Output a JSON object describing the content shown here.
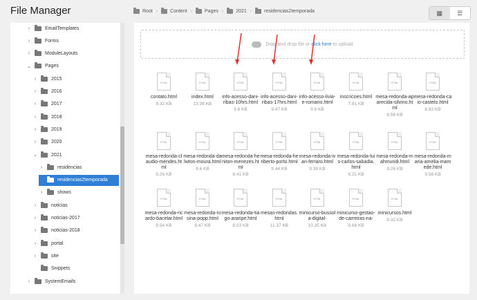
{
  "header": {
    "title": "File Manager"
  },
  "breadcrumb": [
    "Root",
    "Content",
    "Pages",
    "2021",
    "residencias2temporada"
  ],
  "view_toggle": {
    "grid_icon": "grid-icon",
    "list_icon": "list-icon"
  },
  "sidebar": {
    "items": [
      {
        "label": "EmailTemplates",
        "expanded": false
      },
      {
        "label": "Forms",
        "expanded": false
      },
      {
        "label": "ModuleLayouts",
        "expanded": false
      },
      {
        "label": "Pages",
        "expanded": true
      },
      {
        "label": "2015",
        "expanded": false
      },
      {
        "label": "2016",
        "expanded": false
      },
      {
        "label": "2017",
        "expanded": false
      },
      {
        "label": "2018",
        "expanded": false
      },
      {
        "label": "2019",
        "expanded": false
      },
      {
        "label": "2020",
        "expanded": false
      },
      {
        "label": "2021",
        "expanded": true
      },
      {
        "label": "residencias",
        "expanded": false
      },
      {
        "label": "residencias2temporada",
        "expanded": false,
        "selected": true
      },
      {
        "label": "shows",
        "expanded": false
      },
      {
        "label": "noticias",
        "expanded": false
      },
      {
        "label": "noticias-2017",
        "expanded": false
      },
      {
        "label": "noticias-2018",
        "expanded": false
      },
      {
        "label": "portal",
        "expanded": false
      },
      {
        "label": "site",
        "expanded": false
      },
      {
        "label": "Snippets",
        "expanded": false
      },
      {
        "label": "SystemEmails",
        "expanded": false
      }
    ]
  },
  "dropzone": {
    "before": "Drag and drop file or",
    "link": "click here",
    "after": "to upload"
  },
  "files": [
    {
      "name": "contato.html",
      "size": "8.32 KB"
    },
    {
      "name": "index.html",
      "size": "13.98 KB"
    },
    {
      "name": "info-acesso-dani-ribas-10hrs.html",
      "size": "9.6 KB"
    },
    {
      "name": "info-acesso-dani-ribas-17hrs.html",
      "size": "9.47 KB"
    },
    {
      "name": "info-acesso-livia-e-romario.html",
      "size": "9.6 KB"
    },
    {
      "name": "inscricoes.html",
      "size": "7.81 KB"
    },
    {
      "name": "mesa-redonda-aparecida-silvino.html",
      "size": "8.98 KB"
    },
    {
      "name": "mesa-redonda-caio-castelo.html",
      "size": "8.92 KB"
    },
    {
      "name": "mesa-redonda-claudio-mendes.html",
      "size": "9.26 KB"
    },
    {
      "name": "mesa-redonda-dalwton-moura.html",
      "size": "8.6 KB"
    },
    {
      "name": "mesa-redonda-heniton-menezes.html",
      "size": "8.41 KB"
    },
    {
      "name": "mesa-redonda-heriberto-porto.html",
      "size": "9.44 KB"
    },
    {
      "name": "mesa-redonda-ivan-ferraro.html",
      "size": "9.36 KB"
    },
    {
      "name": "mesa-redonda-luis-carlos-sabadia.html",
      "size": "9.22 KB"
    },
    {
      "name": "mesa-redonda-mahmundi.html",
      "size": "9.26 KB"
    },
    {
      "name": "mesa-redonda-maria-amelia-mamede.html",
      "size": "9.58 KB"
    },
    {
      "name": "mesa-redonda-ricardo-bacelar.html",
      "size": "8.54 KB"
    },
    {
      "name": "mesa-redonda-rosina-popp.html",
      "size": "9.47 KB"
    },
    {
      "name": "mesa-redonda-tiago-araripe.html",
      "size": "8.03 KB"
    },
    {
      "name": "mesas-redondas.html",
      "size": "11.37 KB"
    },
    {
      "name": "minicurso-bussola-digital-",
      "size": "10.35 KB"
    },
    {
      "name": "minicurso-gestao-de-carreiras-na-",
      "size": "9.68 KB"
    },
    {
      "name": "minicursos.html",
      "size": "9.32 KB"
    }
  ],
  "file_type_tag": "HTML",
  "colors": {
    "selected": "#2f7fd6",
    "arrow": "#e0312b"
  }
}
